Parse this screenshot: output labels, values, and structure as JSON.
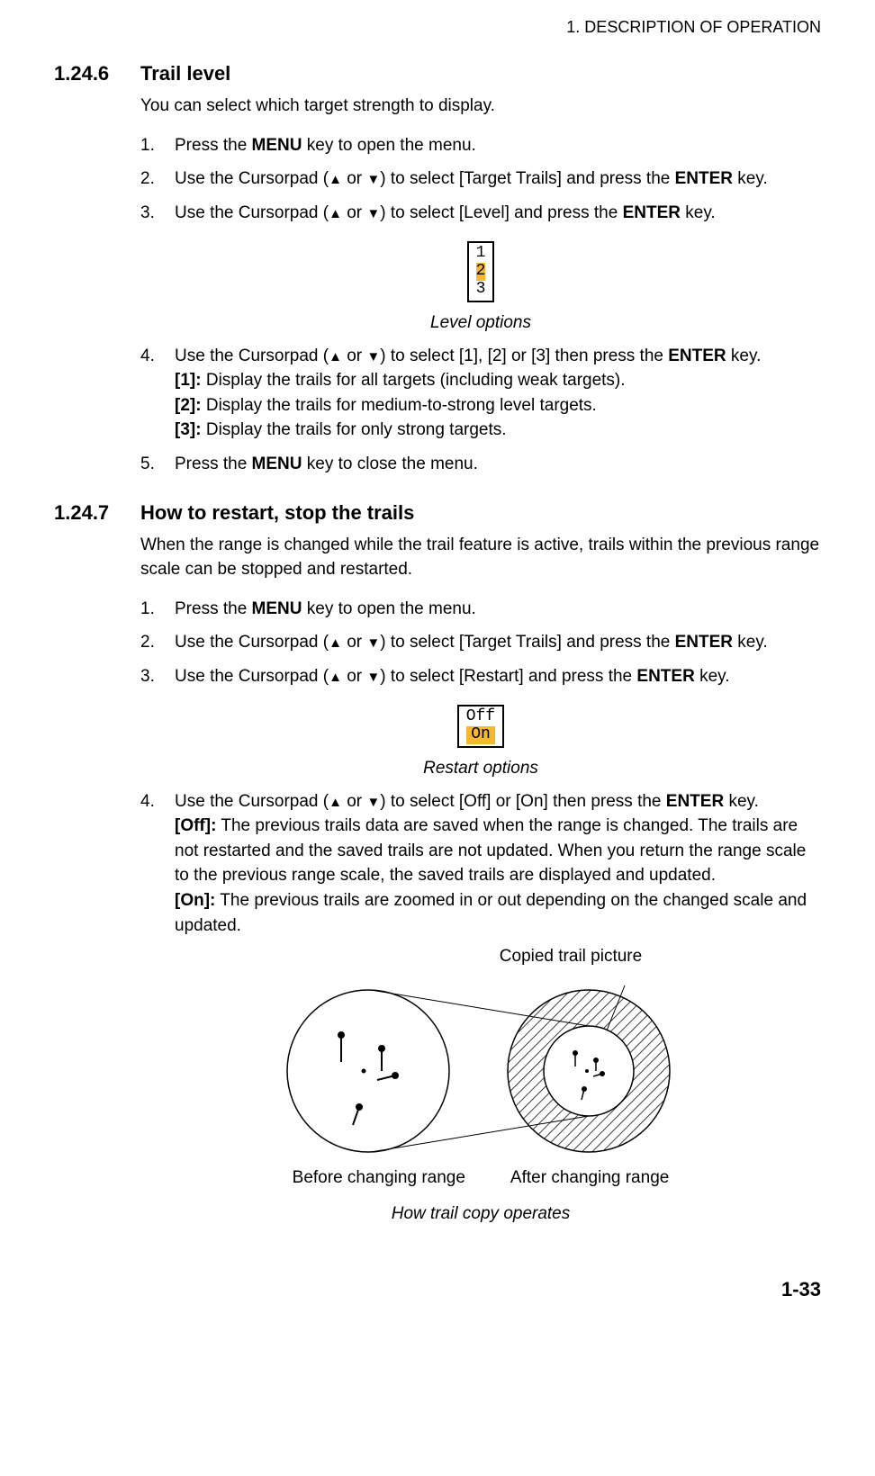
{
  "header": "1.  DESCRIPTION OF OPERATION",
  "section1": {
    "number": "1.24.6",
    "title": "Trail level",
    "intro": "You can select which target strength to display.",
    "steps": {
      "s1": {
        "num": "1.",
        "pre": "Press the ",
        "b1": "MENU",
        "post": " key to open the menu."
      },
      "s2": {
        "num": "2.",
        "pre": "Use the Cursorpad (",
        "mid": " or ",
        "post1": ") to select [Target Trails] and press the ",
        "b1": "ENTER",
        "post2": " key."
      },
      "s3": {
        "num": "3.",
        "pre": "Use the Cursorpad (",
        "mid": " or ",
        "post1": ") to select [Level] and press the ",
        "b1": "ENTER",
        "post2": " key."
      },
      "s4": {
        "num": "4.",
        "pre": "Use the Cursorpad (",
        "mid": " or ",
        "post1": ") to select [1], [2] or [3] then press the ",
        "b1": "ENTER",
        "post2": " key.",
        "d1b": "[1]:",
        "d1": " Display the trails for all targets (including weak targets).",
        "d2b": "[2]:",
        "d2": " Display the trails for medium-to-strong level targets.",
        "d3b": "[3]:",
        "d3": " Display the trails for only strong targets."
      },
      "s5": {
        "num": "5.",
        "pre": "Press the ",
        "b1": "MENU",
        "post": " key to close the menu."
      }
    },
    "menu": {
      "opt1": "1",
      "opt2": "2",
      "opt3": "3"
    },
    "menuCaption": "Level options"
  },
  "section2": {
    "number": "1.24.7",
    "title": "How to restart, stop the trails",
    "intro": "When the range is changed while the trail feature is active, trails within the previous range scale can be stopped and restarted.",
    "steps": {
      "s1": {
        "num": "1.",
        "pre": "Press the ",
        "b1": "MENU",
        "post": " key to open the menu."
      },
      "s2": {
        "num": "2.",
        "pre": "Use the Cursorpad (",
        "mid": " or ",
        "post1": ") to select [Target Trails] and press the ",
        "b1": "ENTER",
        "post2": " key."
      },
      "s3": {
        "num": "3.",
        "pre": "Use the Cursorpad (",
        "mid": " or ",
        "post1": ") to select [Restart] and press the ",
        "b1": "ENTER",
        "post2": " key."
      },
      "s4": {
        "num": "4.",
        "pre": "Use the Cursorpad (",
        "mid": " or ",
        "post1": ") to select [Off] or [On] then press the ",
        "b1": "ENTER",
        "post2": " key.",
        "d1b": "[Off]:",
        "d1": " The previous trails data are saved when the range is changed. The trails are not restarted and the saved trails are not updated. When you return the range scale to the previous range scale, the saved trails are displayed and updated.",
        "d2b": "[On]:",
        "d2": " The previous trails are zoomed in or out depending on the changed scale and updated."
      }
    },
    "menu": {
      "opt1": "Off",
      "opt2": "On"
    },
    "menuCaption": "Restart options",
    "diagram": {
      "topLabel": "Copied trail picture",
      "leftLabel": "Before changing range",
      "rightLabel": "After changing range",
      "caption": "How trail copy operates"
    }
  },
  "pageNumber": "1-33"
}
